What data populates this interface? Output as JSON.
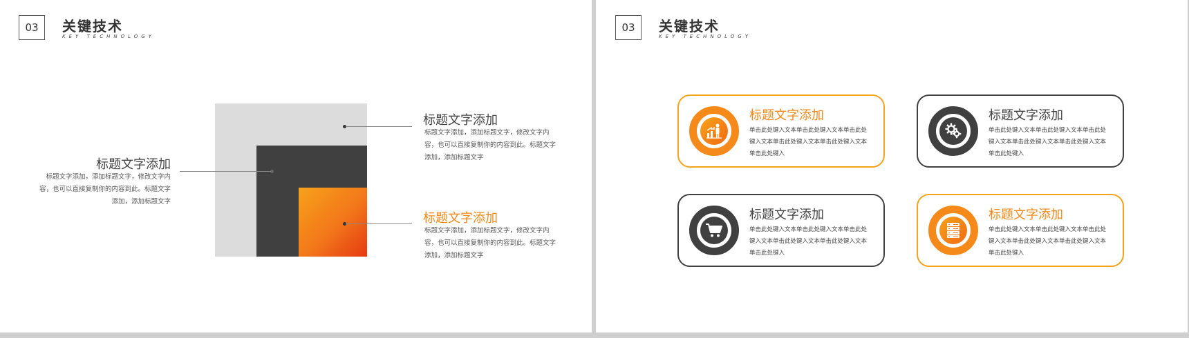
{
  "left_slide": {
    "number": "03",
    "title": "关键技术",
    "subtitle": "KEY TECHNOLOGY",
    "blocks": [
      {
        "title": "标题文字添加",
        "body": "标题文字添加，添加标题文字，修改文字内容，也可以直接复制你的内容到此。标题文字添加，添加标题文字"
      },
      {
        "title": "标题文字添加",
        "body": "标题文字添加，添加标题文字，修改文字内容，也可以直接复制你的内容到此。标题文字添加，添加标题文字"
      },
      {
        "title": "标题文字添加",
        "body": "标题文字添加，添加标题文字，修改文字内容，也可以直接复制你的内容到此。标题文字添加，添加标题文字"
      }
    ]
  },
  "right_slide": {
    "number": "03",
    "title": "关键技术",
    "subtitle": "KEY TECHNOLOGY",
    "cards": [
      {
        "title": "标题文字添加",
        "body": "单击此处键入文本单击此处键入文本单击此处键入文本单击此处键入文本单击此处键入文本单击此处键入",
        "icon": "growth-people-icon",
        "style": "orange"
      },
      {
        "title": "标题文字添加",
        "body": "单击此处键入文本单击此处键入文本单击此处键入文本单击此处键入文本单击此处键入文本单击此处键入",
        "icon": "gears-icon",
        "style": "dark"
      },
      {
        "title": "标题文字添加",
        "body": "单击此处键入文本单击此处键入文本单击此处键入文本单击此处键入文本单击此处键入文本单击此处键入",
        "icon": "shopping-cart-icon",
        "style": "dark"
      },
      {
        "title": "标题文字添加",
        "body": "单击此处键入文本单击此处键入文本单击此处键入文本单击此处键入文本单击此处键入文本单击此处键入",
        "icon": "server-stack-icon",
        "style": "orange"
      }
    ]
  },
  "colors": {
    "accent": "#f7a21b",
    "accent_deep": "#e53a12",
    "dark": "#404040",
    "light": "#dcdcdc"
  }
}
